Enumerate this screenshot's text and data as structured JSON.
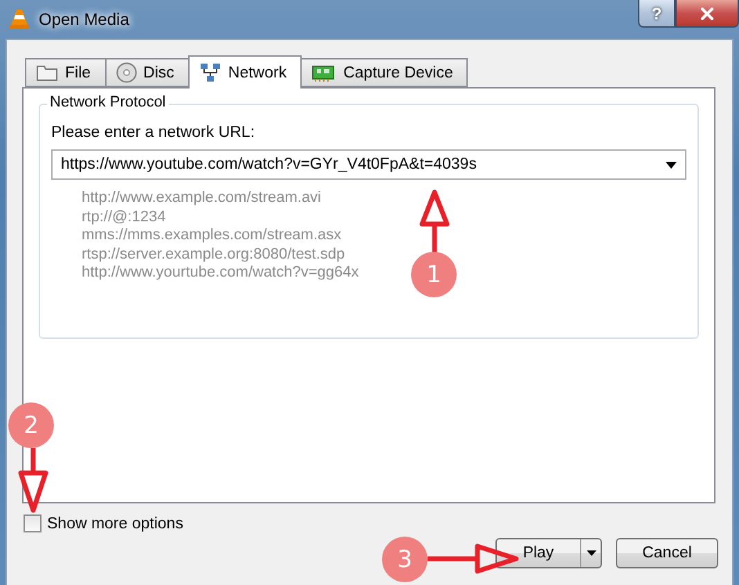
{
  "window": {
    "title": "Open Media",
    "help_button": "?"
  },
  "tabs": [
    {
      "label": "File",
      "selected": false
    },
    {
      "label": "Disc",
      "selected": false
    },
    {
      "label": "Network",
      "selected": true
    },
    {
      "label": "Capture Device",
      "selected": false
    }
  ],
  "network_protocol": {
    "title": "Network Protocol",
    "prompt": "Please enter a network URL:",
    "url": "https://www.youtube.com/watch?v=GYr_V4t0FpA&t=4039s",
    "examples": [
      "http://www.example.com/stream.avi",
      "rtp://@:1234",
      "mms://mms.examples.com/stream.asx",
      "rtsp://server.example.org:8080/test.sdp",
      "http://www.yourtube.com/watch?v=gg64x"
    ]
  },
  "show_more_options": {
    "label": "Show more options",
    "checked": false
  },
  "buttons": [
    {
      "label": "Play",
      "kind": "split"
    },
    {
      "label": "Cancel",
      "kind": "plain"
    }
  ],
  "annotations": [
    {
      "number": "1",
      "kind": "up"
    },
    {
      "number": "2",
      "kind": "down"
    },
    {
      "number": "3",
      "kind": "right"
    }
  ]
}
